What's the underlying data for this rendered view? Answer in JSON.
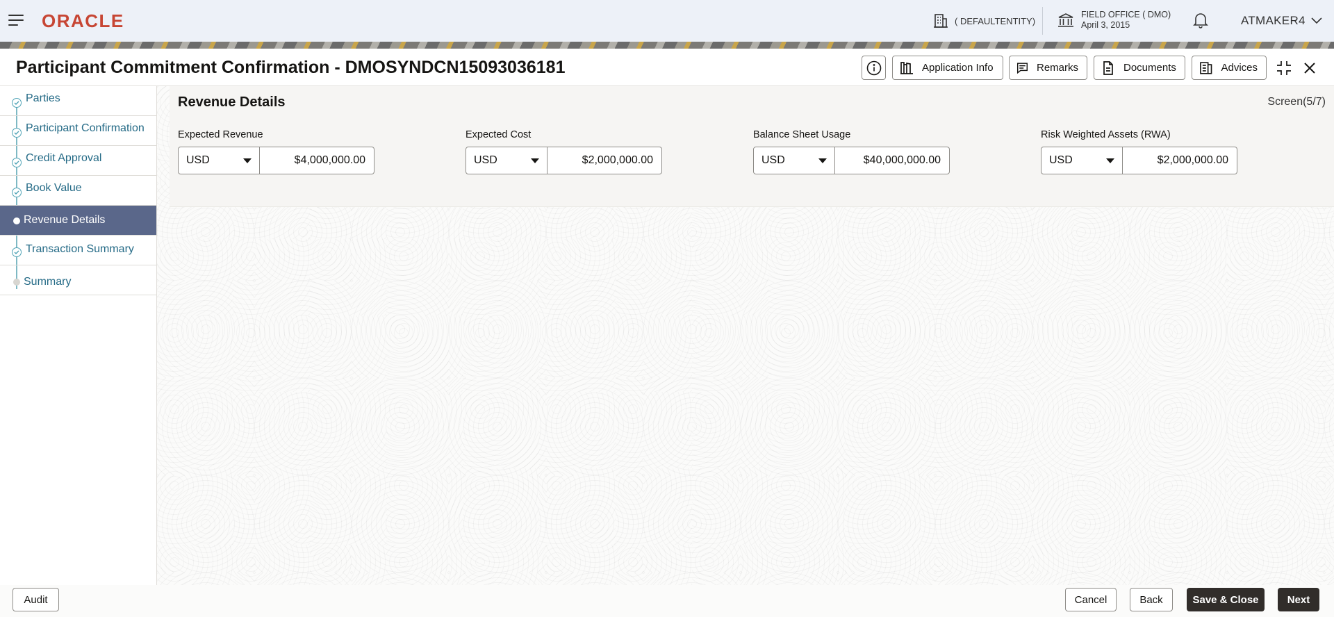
{
  "topbar": {
    "brand": "ORACLE",
    "entity": "( DEFAULTENTITY)",
    "office_name": "FIELD OFFICE ( DMO)",
    "office_date": "April 3, 2015",
    "user": "ATMAKER4"
  },
  "modal": {
    "title": "Participant Commitment Confirmation - DMOSYNDCN15093036181",
    "header_buttons": {
      "application_info": "Application Info",
      "remarks": "Remarks",
      "documents": "Documents",
      "advices": "Advices"
    }
  },
  "steps": [
    {
      "label": "Parties",
      "state": "done"
    },
    {
      "label": "Participant Confirmation",
      "state": "done"
    },
    {
      "label": "Credit Approval",
      "state": "done"
    },
    {
      "label": "Book Value",
      "state": "done"
    },
    {
      "label": "Revenue Details",
      "state": "active"
    },
    {
      "label": "Transaction Summary",
      "state": "done"
    },
    {
      "label": "Summary",
      "state": "pending"
    }
  ],
  "section": {
    "title": "Revenue Details",
    "screen": "Screen(5/7)",
    "fields": [
      {
        "label": "Expected Revenue",
        "currency": "USD",
        "amount": "$4,000,000.00"
      },
      {
        "label": "Expected Cost",
        "currency": "USD",
        "amount": "$2,000,000.00"
      },
      {
        "label": "Balance Sheet Usage",
        "currency": "USD",
        "amount": "$40,000,000.00"
      },
      {
        "label": "Risk Weighted Assets (RWA)",
        "currency": "USD",
        "amount": "$2,000,000.00"
      }
    ]
  },
  "footer": {
    "audit": "Audit",
    "cancel": "Cancel",
    "back": "Back",
    "save_close": "Save & Close",
    "next": "Next"
  },
  "colors": {
    "brand_red": "#c74634",
    "active_step": "#5a678a",
    "step_text": "#246a86",
    "primary_button": "#312d2a"
  },
  "icons": [
    "hamburger-icon",
    "building-icon",
    "bank-icon",
    "bell-icon",
    "chevron-down-icon",
    "info-icon",
    "application-info-icon",
    "remarks-icon",
    "documents-icon",
    "advices-icon",
    "expand-icon",
    "close-icon",
    "check-circle-icon",
    "caret-down-icon"
  ]
}
